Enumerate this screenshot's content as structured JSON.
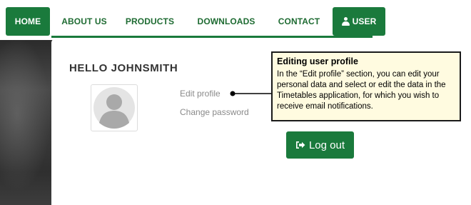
{
  "nav": {
    "home_label": "HOME",
    "about_label": "ABOUT US",
    "products_label": "PRODUCTS",
    "downloads_label": "DOWNLOADS",
    "contact_label": "CONTACT",
    "user_label": "USER",
    "user_icon": "user-icon"
  },
  "profile": {
    "greeting": "HELLO JOHNSMITH",
    "avatar_icon": "avatar-placeholder-icon",
    "edit_profile_label": "Edit profile",
    "change_password_label": "Change password"
  },
  "callout": {
    "title": "Editing user profile",
    "body": "In the “Edit profile” section, you can edit your personal data and select or edit the data in the Timetables application, for which you wish to receive email notifications."
  },
  "logout": {
    "label": "Log out",
    "icon": "sign-out-icon"
  },
  "colors": {
    "accent": "#1a7a3c",
    "callout_background": "#fffbe0"
  }
}
